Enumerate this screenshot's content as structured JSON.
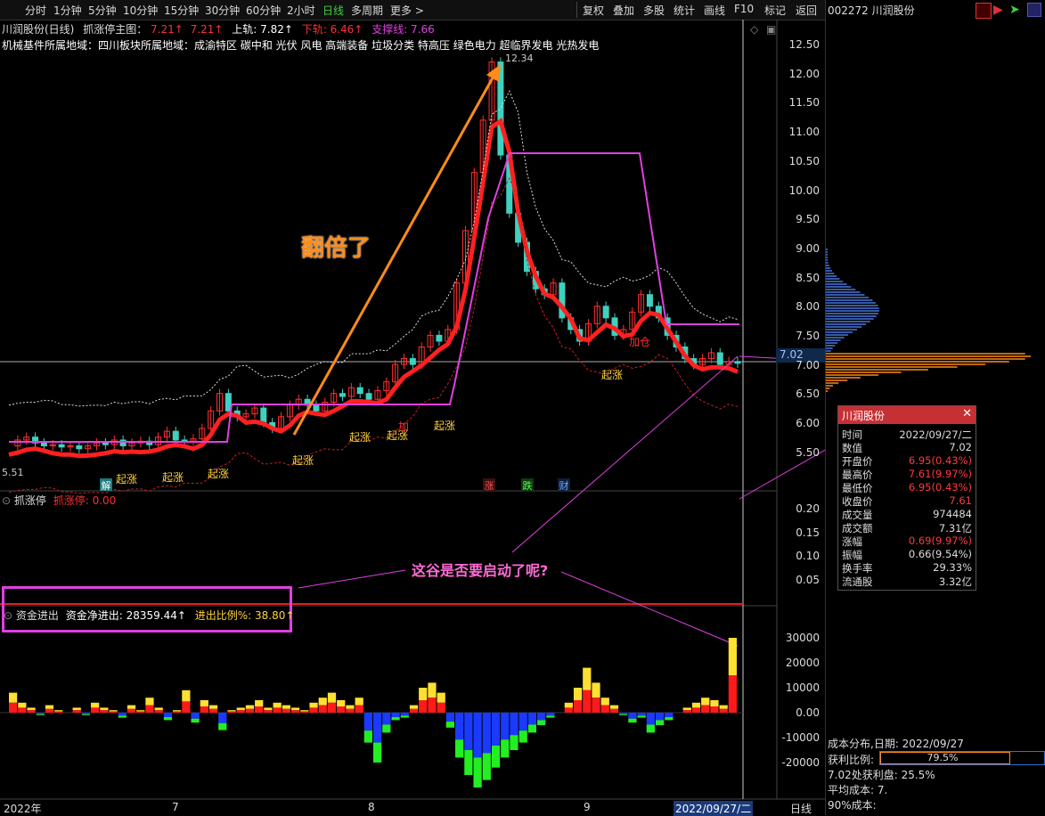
{
  "toolbar": {
    "periods": [
      "分时",
      "1分钟",
      "5分钟",
      "10分钟",
      "15分钟",
      "30分钟",
      "60分钟",
      "2小时",
      "日线",
      "多周期",
      "更多 >"
    ],
    "active": "日线",
    "right": [
      "复权",
      "叠加",
      "多股",
      "统计",
      "画线",
      "F10",
      "标记",
      "返回"
    ]
  },
  "header": {
    "stock_name": "川润股份(日线)",
    "indicator_name": "抓涨停主图：",
    "v1": "7.21↑",
    "v2": "7.21↑",
    "upper_label": "上轨: 7.82↑",
    "lower_label": "下轨: 6.46↑",
    "support_label": "支撑线: 7.66",
    "concepts": "机械基件所属地域：四川板块所属地域：成渝特区 碳中和 光伏 风电 高端装备 垃圾分类 特高压 绿色电力 超临界发电 光热发电"
  },
  "main_chart": {
    "price_axis": [
      "12.50",
      "12.00",
      "11.50",
      "11.00",
      "10.50",
      "10.00",
      "9.50",
      "9.00",
      "8.50",
      "8.00",
      "7.50",
      "7.00",
      "6.50",
      "6.00",
      "5.50"
    ],
    "peak_label": "12.34",
    "current_price_label": "7.02",
    "left_edge_label": "5.51",
    "double_text": "翻倍了",
    "signal_labels": [
      "起涨",
      "起涨",
      "起涨",
      "起涨",
      "起涨",
      "起涨",
      "起涨"
    ],
    "add_labels": [
      "加仓",
      "加"
    ],
    "bottom_markers": [
      "解",
      "涨",
      "跌",
      "财"
    ],
    "misc_labels": [
      "起涨",
      "起涨"
    ]
  },
  "sub1": {
    "title": "抓涨停",
    "value": "抓涨停: 0.00",
    "axis": [
      "0.20",
      "0.15",
      "0.10",
      "0.05"
    ],
    "question": "这谷是否要启动了呢?"
  },
  "sub2": {
    "title": "资金进出",
    "net_label": "资金净进出: 28359.44↑",
    "ratio_label": "进出比例%: 38.80↑",
    "axis": [
      "30000",
      "20000",
      "10000",
      "0.00",
      "-10000",
      "-20000"
    ]
  },
  "x_axis": {
    "labels": [
      "2022年",
      "7",
      "8",
      "9",
      "2022/09/27/二"
    ],
    "period": "日线"
  },
  "right_panel": {
    "code_title": "002272 川润股份",
    "info": {
      "title": "川润股份",
      "rows": [
        {
          "k": "时间",
          "v": "2022/09/27/二",
          "c": "#ddd"
        },
        {
          "k": "数值",
          "v": "7.02",
          "c": "#ddd"
        },
        {
          "k": "开盘价",
          "v": "6.95(0.43%)",
          "c": "#ff3b3b"
        },
        {
          "k": "最高价",
          "v": "7.61(9.97%)",
          "c": "#ff3b3b"
        },
        {
          "k": "最低价",
          "v": "6.95(0.43%)",
          "c": "#ff3b3b"
        },
        {
          "k": "收盘价",
          "v": "7.61",
          "c": "#ff3b3b"
        },
        {
          "k": "成交量",
          "v": "974484",
          "c": "#ddd"
        },
        {
          "k": "成交额",
          "v": "7.31亿",
          "c": "#ddd"
        },
        {
          "k": "涨幅",
          "v": "0.69(9.97%)",
          "c": "#ff3b3b"
        },
        {
          "k": "振幅",
          "v": "0.66(9.54%)",
          "c": "#ddd"
        },
        {
          "k": "换手率",
          "v": "29.33%",
          "c": "#ddd"
        },
        {
          "k": "流通股",
          "v": "3.32亿",
          "c": "#ddd"
        }
      ]
    },
    "cost": {
      "title": "成本分布,日期: 2022/09/27",
      "profit_label": "获利比例:",
      "profit_value": "79.5%",
      "profit_ratio": 0.795,
      "profit_at": "7.02处获利盘: 25.5%",
      "avg_cost": "平均成本: 7.",
      "cost90": "90%成本:"
    }
  },
  "colors": {
    "up": "#ff3030",
    "down": "#3fd1c0",
    "magenta": "#e040e0",
    "orange": "#ff8c1a",
    "bg": "#000000"
  }
}
